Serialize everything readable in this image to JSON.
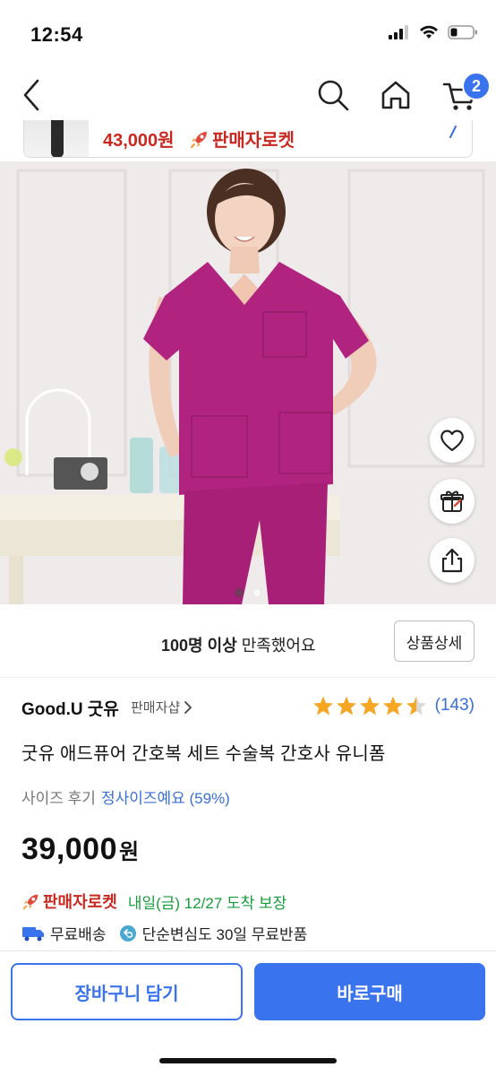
{
  "status_bar": {
    "time": "12:54"
  },
  "nav": {
    "cart_badge": "2"
  },
  "sticky_strip": {
    "price": "43,000원",
    "rocket_label": "판매자로켓"
  },
  "hero": {
    "slide_count": 2,
    "active_slide": 1
  },
  "satisfaction": {
    "count": "100명 이상",
    "text": " 만족했어요",
    "detail_button": "상품상세"
  },
  "seller": {
    "name": "Good.U 굿유",
    "shop_link": "판매자샵"
  },
  "rating": {
    "stars": 4.5,
    "count": "(143)",
    "star_color": "#f5a623"
  },
  "product": {
    "title": "굿유 애드퓨어 간호복 세트 수술복 간호사 유니폼"
  },
  "size_review": {
    "label": "사이즈 후기",
    "value": "정사이즈예요 (59%)"
  },
  "price": {
    "amount": "39,000",
    "currency": "원"
  },
  "delivery": {
    "rocket_label": "판매자로켓",
    "arrival": "내일(금) 12/27 도착 보장"
  },
  "shipping": {
    "free_shipping": "무료배송",
    "return_policy": "단순변심도 30일 무료반품"
  },
  "bottom_bar": {
    "cart_button": "장바구니 담기",
    "buy_button": "바로구매"
  },
  "colors": {
    "accent": "#3a73ee",
    "rocket": "#c8281f",
    "arrival": "#179c3b",
    "link": "#3a6fd8",
    "scrub": "#b0237e"
  },
  "icons": [
    "back-icon",
    "search-icon",
    "home-icon",
    "cart-icon",
    "heart-icon",
    "gift-icon",
    "share-icon",
    "truck-icon",
    "return-icon",
    "rocket-icon",
    "chevron-right-icon"
  ]
}
